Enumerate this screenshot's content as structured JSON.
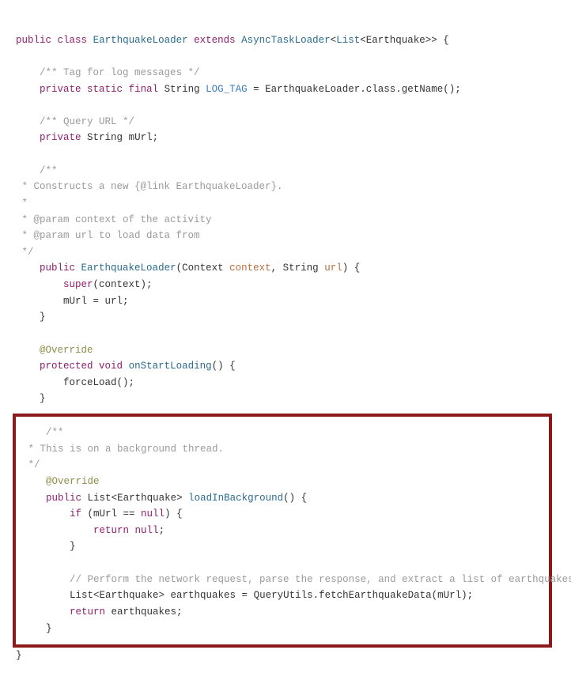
{
  "code": {
    "line1_public": "public",
    "line1_class": "class",
    "line1_name": "EarthquakeLoader",
    "line1_extends": "extends",
    "line1_super": "AsyncTaskLoader",
    "line1_generic_open": "<",
    "line1_list": "List",
    "line1_inner": "<Earthquake>>",
    "line1_brace": " {",
    "blank": "",
    "c_tag": "/** Tag for log messages */",
    "l_private": "private",
    "l_static": "static",
    "l_final": "final",
    "l_string": "String",
    "l_logtag": "LOG_TAG",
    "l_eq": " = ",
    "l_rhs1": "EarthquakeLoader",
    "l_rhs2": ".class.getName();",
    "c_query": "/** Query URL */",
    "murl_decl": "mUrl;",
    "c_ctor1": "/**",
    "c_ctor2": " * Constructs a new {@link EarthquakeLoader}.",
    "c_ctor3": " *",
    "c_ctor4": " * @param context of the activity",
    "c_ctor5": " * @param url to load data from",
    "c_ctor6": " */",
    "ctor_name": "EarthquakeLoader",
    "ctor_context_t": "Context",
    "ctor_context_p": "context",
    "ctor_string_t": "String",
    "ctor_url_p": "url",
    "ctor_sig_end": ") {",
    "ctor_super": "super",
    "ctor_super_arg": "(context);",
    "ctor_assign": "mUrl = url;",
    "brace_close": "}",
    "ann_override": "@Override",
    "protected": "protected",
    "void": "void",
    "onstart": "onStartLoading",
    "onstart_sig": "() {",
    "forceload": "forceLoad();",
    "hl_c1": "/**",
    "hl_c2": " * This is on a background thread.",
    "hl_c3": " */",
    "hl_list": "List",
    "hl_eq": "<Earthquake>",
    "hl_method": "loadInBackground",
    "hl_sig": "() {",
    "hl_if": "if",
    "hl_cond": " (mUrl == ",
    "hl_null": "null",
    "hl_cond_end": ") {",
    "hl_return": "return",
    "hl_null2": "null",
    "hl_semi": ";",
    "hl_comment": "// Perform the network request, parse the response, and extract a list of earthquakes.",
    "hl_decl_list": "List",
    "hl_decl_eq": "<Earthquake> earthquakes = QueryUtils.fetchEarthquakeData(mUrl);",
    "hl_ret2": "return",
    "hl_ret2_v": " earthquakes;"
  }
}
